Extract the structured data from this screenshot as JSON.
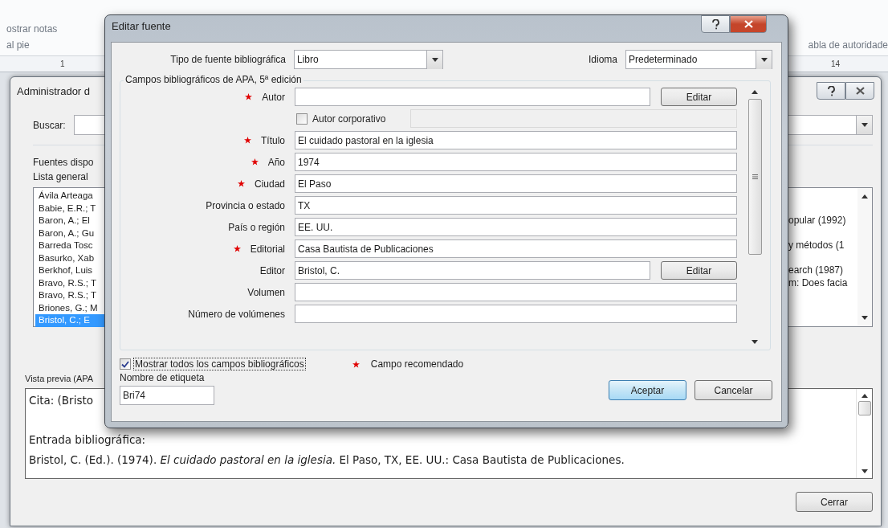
{
  "ribbon": {
    "texts": [
      "ostrar notas",
      "al pie"
    ],
    "right_text": "abla de autoridade",
    "ruler_labels": [
      "1",
      "14"
    ]
  },
  "source_manager": {
    "title": "Administrador d",
    "search_label": "Buscar:",
    "available_label": "Fuentes dispo",
    "master_list_label": "Lista general",
    "master_list": [
      {
        "text": "Ávila Arteaga",
        "selected": false
      },
      {
        "text": "Babie, E.R.; T",
        "selected": false
      },
      {
        "text": "Baron, A.; El",
        "selected": false
      },
      {
        "text": "Baron, A.; Gu",
        "selected": false
      },
      {
        "text": "Barreda Tosc",
        "selected": false
      },
      {
        "text": "Basurko, Xab",
        "selected": false
      },
      {
        "text": "Berkhof, Luis",
        "selected": false
      },
      {
        "text": "Bravo, R.S.; T",
        "selected": false
      },
      {
        "text": "Bravo, R.S.; T",
        "selected": false
      },
      {
        "text": "Briones, G.; M",
        "selected": false
      },
      {
        "text": "Bristol, C.;  E",
        "selected": true
      }
    ],
    "current_list": [
      "opular (1992)",
      "y métodos (1",
      "earch  (1987)",
      "m: Does facia"
    ],
    "preview_label": "Vista previa (APA",
    "preview": {
      "citation": "Cita:  (Bristo",
      "entry_label": "Entrada bibliográfica:",
      "entry": "Bristol, C. (Ed.). (1974). *El cuidado pastoral en la iglesia.* El Paso, TX, EE. UU.: Casa Bautista de Publicaciones."
    },
    "close_button": "Cerrar"
  },
  "edit_source": {
    "title": "Editar fuente",
    "source_type_label": "Tipo de fuente bibliográfica",
    "source_type": "Libro",
    "language_label": "Idioma",
    "language": "Predeterminado",
    "group_title": "Campos bibliográficos de APA, 5ª edición",
    "fields": [
      {
        "kind": "text",
        "label": "Autor",
        "required": true,
        "button": "Editar"
      },
      {
        "kind": "checkbox",
        "label": "Autor corporativo",
        "checked": false
      },
      {
        "kind": "text",
        "label": "Título",
        "required": true,
        "value": "El cuidado pastoral en la iglesia"
      },
      {
        "kind": "text",
        "label": "Año",
        "required": true,
        "value": "1974"
      },
      {
        "kind": "text",
        "label": "Ciudad",
        "required": true,
        "value": "El Paso"
      },
      {
        "kind": "text",
        "label": "Provincia o estado",
        "required": false,
        "value": "TX"
      },
      {
        "kind": "text",
        "label": "País o región",
        "required": false,
        "value": "EE. UU."
      },
      {
        "kind": "text",
        "label": "Editorial",
        "required": true,
        "value": "Casa Bautista de Publicaciones"
      },
      {
        "kind": "text",
        "label": "Editor",
        "required": false,
        "value": "Bristol, C.",
        "button": "Editar"
      },
      {
        "kind": "text",
        "label": "Volumen",
        "required": false
      },
      {
        "kind": "text",
        "label": "Número de volúmenes",
        "required": false
      }
    ],
    "show_all": {
      "label": "Mostrar todos los campos bibliográficos",
      "checked": true
    },
    "legend": "Campo recomendado",
    "tag_label": "Nombre de etiqueta",
    "tag_value": "Bri74",
    "buttons": [
      {
        "label": "Aceptar",
        "default": true
      },
      {
        "label": "Cancelar",
        "default": false
      }
    ]
  }
}
